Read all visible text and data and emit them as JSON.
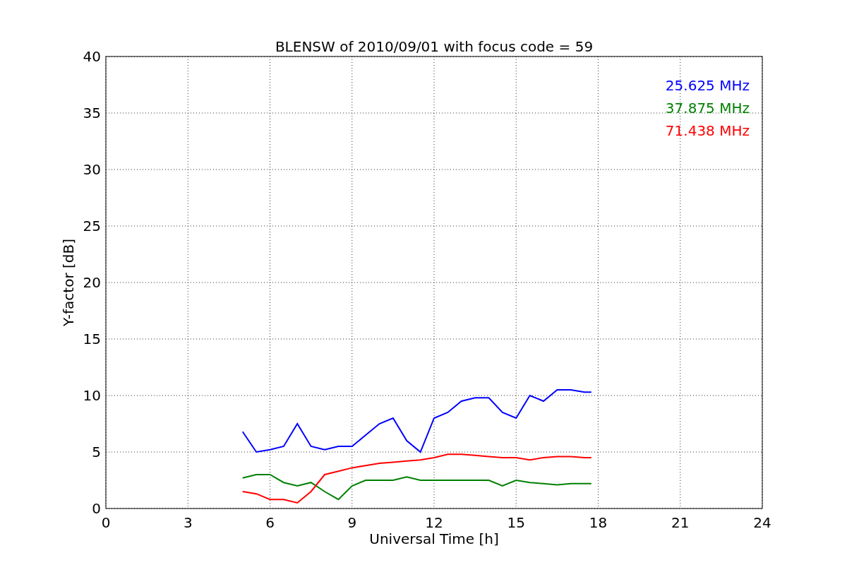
{
  "chart_data": {
    "type": "line",
    "title": "BLENSW of 2010/09/01 with focus code = 59",
    "xlabel": "Universal Time [h]",
    "ylabel": "Y-factor [dB]",
    "x": [
      5,
      5.5,
      6,
      6.5,
      7,
      7.5,
      8,
      8.5,
      9,
      9.5,
      10,
      10.5,
      11,
      11.5,
      12,
      12.5,
      13,
      13.5,
      14,
      14.5,
      15,
      15.5,
      16,
      16.5,
      17,
      17.5,
      17.75
    ],
    "series": [
      {
        "name": "25.625 MHz",
        "color": "#0000ff",
        "values": [
          6.8,
          5,
          5.2,
          5.5,
          7.5,
          5.5,
          5.2,
          5.5,
          5.5,
          6.5,
          7.5,
          8,
          6,
          5,
          8,
          8.5,
          9.5,
          9.8,
          9.8,
          8.5,
          8,
          10,
          9.5,
          10.5,
          10.5,
          10.3,
          10.3
        ]
      },
      {
        "name": "37.875 MHz",
        "color": "#008000",
        "values": [
          2.7,
          3,
          3,
          2.3,
          2,
          2.3,
          1.5,
          0.8,
          2,
          2.5,
          2.5,
          2.5,
          2.8,
          2.5,
          2.5,
          2.5,
          2.5,
          2.5,
          2.5,
          2,
          2.5,
          2.3,
          2.2,
          2.1,
          2.2,
          2.2,
          2.2
        ]
      },
      {
        "name": "71.438 MHz",
        "color": "#ff0000",
        "values": [
          1.5,
          1.3,
          0.8,
          0.8,
          0.5,
          1.5,
          3,
          3.3,
          3.6,
          3.8,
          4,
          4.1,
          4.2,
          4.3,
          4.5,
          4.8,
          4.8,
          4.7,
          4.6,
          4.5,
          4.5,
          4.3,
          4.5,
          4.6,
          4.6,
          4.5,
          4.5
        ]
      }
    ],
    "xlim": [
      0,
      24
    ],
    "ylim": [
      0,
      40
    ],
    "xticks": [
      0,
      3,
      6,
      9,
      12,
      15,
      18,
      21,
      24
    ],
    "yticks": [
      0,
      5,
      10,
      15,
      20,
      25,
      30,
      35,
      40
    ],
    "grid": true
  }
}
